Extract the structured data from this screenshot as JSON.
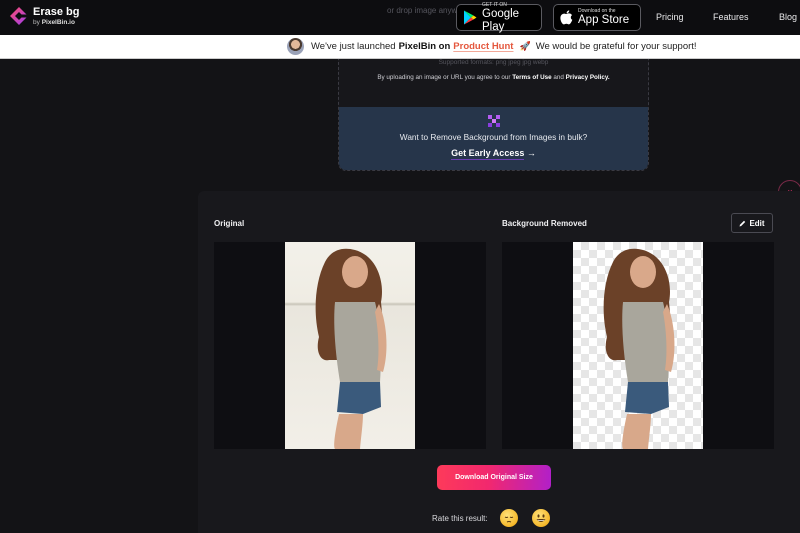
{
  "header": {
    "brand_name": "Erase bg",
    "brand_by": "by",
    "brand_parent": "PixelBin.io",
    "ghost_text": "or drop image anywhere",
    "google_play": {
      "small": "GET IT ON",
      "big": "Google Play"
    },
    "app_store": {
      "small": "Download on the",
      "big": "App Store"
    },
    "nav": [
      "Pricing",
      "Features",
      "Blog"
    ]
  },
  "banner": {
    "prefix": "We've just launched",
    "brand": "PixelBin on",
    "link": "Product Hunt",
    "suffix": "We would be grateful for your support!"
  },
  "upload": {
    "formats_ghost": "Supported formats:  png   jpeg   jpg   webp",
    "terms_prefix": "By uploading an image or URL you agree to our",
    "terms_link": "Terms of Use",
    "terms_and": "and",
    "privacy_link": "Privacy Policy.",
    "bulk_question": "Want to Remove Background from Images in bulk?",
    "bulk_cta": "Get Early Access",
    "bulk_arrow": "→"
  },
  "results": {
    "original_label": "Original",
    "removed_label": "Background Removed",
    "edit_label": "Edit",
    "download_label": "Download Original Size",
    "rate_label": "Rate this result:",
    "close_symbol": "×"
  },
  "colors": {
    "accent_gradient_start": "#fd3a5a",
    "accent_gradient_end": "#b220c8",
    "product_hunt": "#e4573d",
    "bulk_panel": "#26354a"
  }
}
